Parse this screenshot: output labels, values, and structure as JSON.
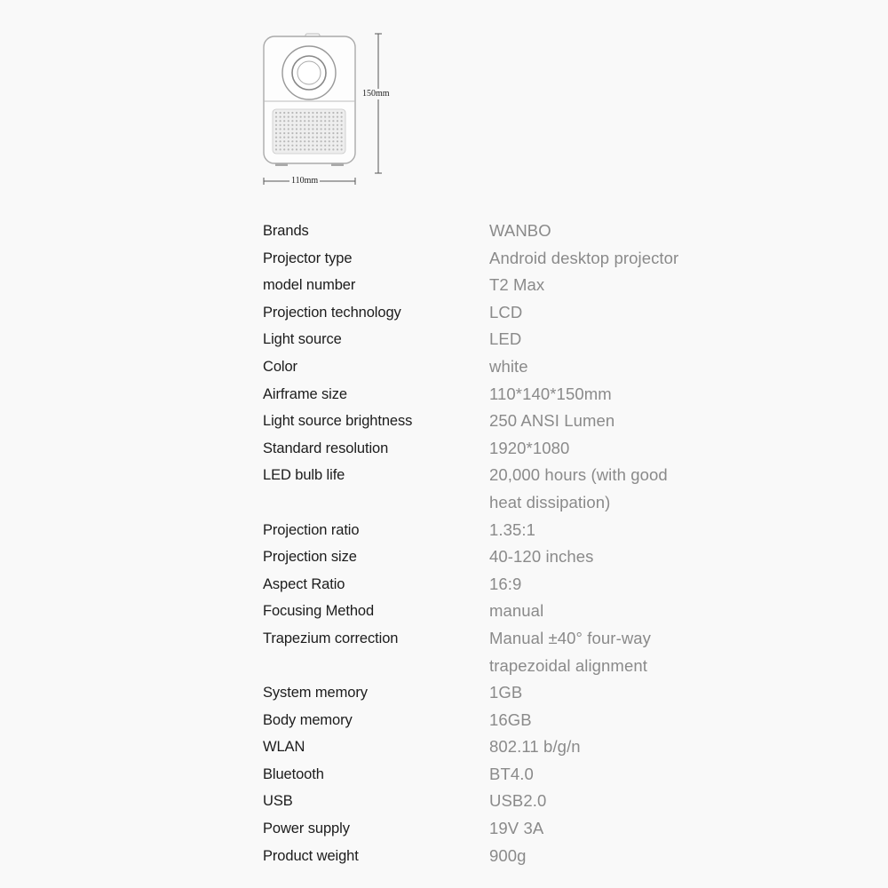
{
  "diagram": {
    "height_label": "150mm",
    "width_label": "110mm",
    "icon": "projector-front-view"
  },
  "specs": [
    {
      "label": "Brands",
      "value": "WANBO"
    },
    {
      "label": "Projector type",
      "value": "Android desktop projector"
    },
    {
      "label": "model number",
      "value": "T2 Max"
    },
    {
      "label": "Projection technology",
      "value": "LCD"
    },
    {
      "label": "Light source",
      "value": "LED"
    },
    {
      "label": "Color",
      "value": "white"
    },
    {
      "label": "Airframe size",
      "value": "110*140*150mm"
    },
    {
      "label": "Light source brightness",
      "value": "250 ANSI Lumen"
    },
    {
      "label": "Standard resolution",
      "value": "1920*1080"
    },
    {
      "label": "LED bulb life",
      "value": "20,000 hours (with good",
      "value2": "heat dissipation)"
    },
    {
      "label": "Projection ratio",
      "value": "1.35:1"
    },
    {
      "label": "Projection size",
      "value": "40-120 inches"
    },
    {
      "label": "Aspect Ratio",
      "value": "16:9"
    },
    {
      "label": "Focusing Method",
      "value": "manual"
    },
    {
      "label": "Trapezium correction",
      "value": "Manual ±40° four-way",
      "value2": "trapezoidal alignment"
    },
    {
      "label": "System memory",
      "value": "1GB"
    },
    {
      "label": "Body memory",
      "value": "16GB"
    },
    {
      "label": "WLAN",
      "value": "802.11 b/g/n"
    },
    {
      "label": "Bluetooth",
      "value": "BT4.0"
    },
    {
      "label": "USB",
      "value": "USB2.0"
    },
    {
      "label": "Power supply",
      "value": "19V 3A"
    },
    {
      "label": "Product weight",
      "value": "900g"
    }
  ]
}
